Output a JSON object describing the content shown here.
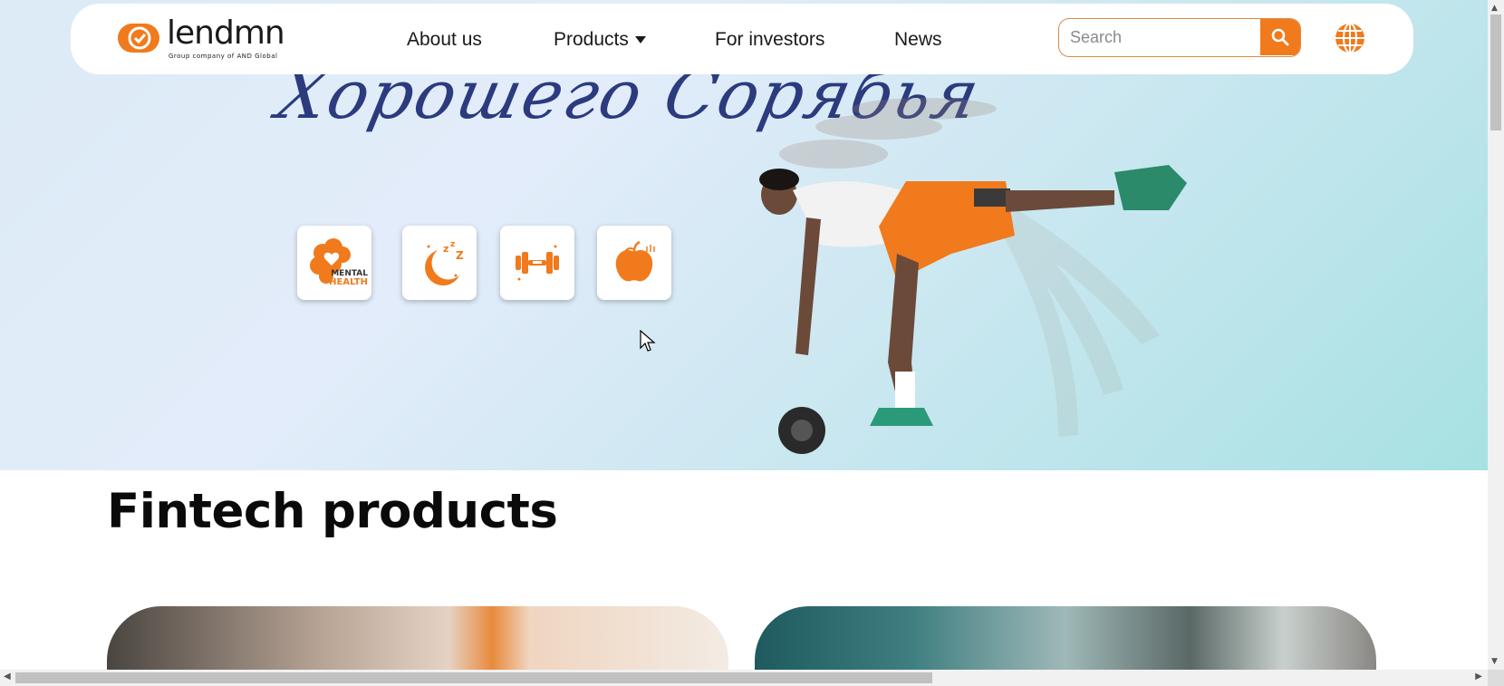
{
  "colors": {
    "accent": "#f07a1c",
    "nav_text": "#1a1a1a",
    "script_text": "#2b3b7e",
    "title": "#0a0a0a"
  },
  "brand": {
    "name": "lendmn",
    "tagline": "Group   company   of   AND Global",
    "icon": "check-circle-icon"
  },
  "nav": {
    "items": [
      {
        "label": "About us"
      },
      {
        "label": "Products",
        "icon": "caret-down-icon"
      },
      {
        "label": "For investors"
      },
      {
        "label": "News"
      }
    ]
  },
  "search": {
    "placeholder": "Search",
    "value": "",
    "icon": "search-icon"
  },
  "language": {
    "icon": "globe-icon"
  },
  "hero": {
    "script_text": "Хорошего Сорябья",
    "tiles": [
      {
        "icon": "brain-heart-icon",
        "label_top": "MENTAL",
        "label_bottom": "HEALTH"
      },
      {
        "icon": "moon-sleep-icon"
      },
      {
        "icon": "dumbbell-icon"
      },
      {
        "icon": "apple-icon"
      }
    ]
  },
  "section": {
    "title": "Fintech products"
  }
}
